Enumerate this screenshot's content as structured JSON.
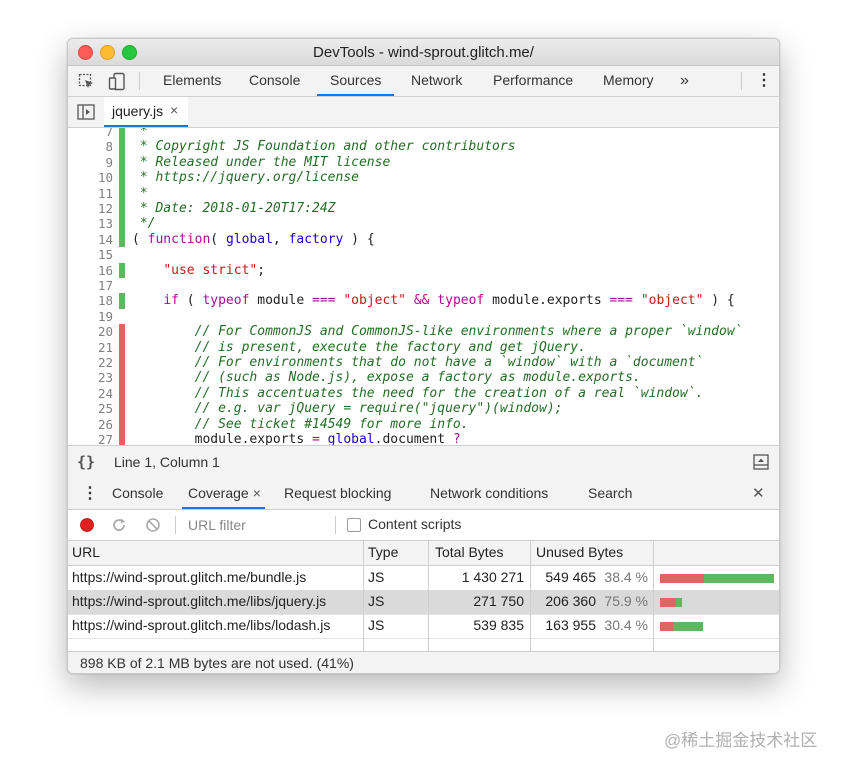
{
  "window": {
    "title": "DevTools - wind-sprout.glitch.me/"
  },
  "main_tabs": [
    "Elements",
    "Console",
    "Sources",
    "Network",
    "Performance",
    "Memory"
  ],
  "main_tabs_active": "Sources",
  "more_tabs_glyph": "»",
  "menu_glyph": "⋮",
  "file_tab": {
    "label": "jquery.js",
    "close": "×"
  },
  "colors": {
    "covered": "#5eb85e",
    "uncovered": "#e06462",
    "accent": "#1a73e8"
  },
  "code_lines": [
    {
      "num": "7",
      "cov": "used",
      "tokens": [
        {
          "t": " *",
          "c": "com"
        }
      ]
    },
    {
      "num": "8",
      "cov": "used",
      "tokens": [
        {
          "t": " * Copyright JS Foundation and other contributors",
          "c": "com"
        }
      ]
    },
    {
      "num": "9",
      "cov": "used",
      "tokens": [
        {
          "t": " * Released under the MIT license",
          "c": "com"
        }
      ]
    },
    {
      "num": "10",
      "cov": "used",
      "tokens": [
        {
          "t": " * https://jquery.org/license",
          "c": "com"
        }
      ]
    },
    {
      "num": "11",
      "cov": "used",
      "tokens": [
        {
          "t": " *",
          "c": "com"
        }
      ]
    },
    {
      "num": "12",
      "cov": "used",
      "tokens": [
        {
          "t": " * Date: 2018-01-20T17:24Z",
          "c": "com"
        }
      ]
    },
    {
      "num": "13",
      "cov": "used",
      "tokens": [
        {
          "t": " */",
          "c": "com"
        }
      ]
    },
    {
      "num": "14",
      "cov": "used",
      "tokens": [
        {
          "t": "( ",
          "c": "plain"
        },
        {
          "t": "function",
          "c": "kw"
        },
        {
          "t": "( ",
          "c": "plain"
        },
        {
          "t": "global",
          "c": "id"
        },
        {
          "t": ", ",
          "c": "plain"
        },
        {
          "t": "factory",
          "c": "id"
        },
        {
          "t": " ) {",
          "c": "plain"
        }
      ]
    },
    {
      "num": "15",
      "cov": "none",
      "tokens": []
    },
    {
      "num": "16",
      "cov": "used",
      "tokens": [
        {
          "t": "    ",
          "c": "plain"
        },
        {
          "t": "\"use strict\"",
          "c": "str"
        },
        {
          "t": ";",
          "c": "plain"
        }
      ]
    },
    {
      "num": "17",
      "cov": "none",
      "tokens": []
    },
    {
      "num": "18",
      "cov": "used",
      "tokens": [
        {
          "t": "    ",
          "c": "plain"
        },
        {
          "t": "if",
          "c": "kw"
        },
        {
          "t": " ( ",
          "c": "plain"
        },
        {
          "t": "typeof",
          "c": "kw"
        },
        {
          "t": " module ",
          "c": "plain"
        },
        {
          "t": "===",
          "c": "kw"
        },
        {
          "t": " ",
          "c": "plain"
        },
        {
          "t": "\"object\"",
          "c": "str"
        },
        {
          "t": " ",
          "c": "plain"
        },
        {
          "t": "&&",
          "c": "kw"
        },
        {
          "t": " ",
          "c": "plain"
        },
        {
          "t": "typeof",
          "c": "kw"
        },
        {
          "t": " module.exports ",
          "c": "plain"
        },
        {
          "t": "===",
          "c": "kw"
        },
        {
          "t": " ",
          "c": "plain"
        },
        {
          "t": "\"object\"",
          "c": "str"
        },
        {
          "t": " ) {",
          "c": "plain"
        }
      ]
    },
    {
      "num": "19",
      "cov": "none",
      "tokens": []
    },
    {
      "num": "20",
      "cov": "unused",
      "tokens": [
        {
          "t": "        ",
          "c": "plain"
        },
        {
          "t": "// For CommonJS and CommonJS-like environments where a proper `window`",
          "c": "lcom"
        }
      ]
    },
    {
      "num": "21",
      "cov": "unused",
      "tokens": [
        {
          "t": "        ",
          "c": "plain"
        },
        {
          "t": "// is present, execute the factory and get jQuery.",
          "c": "lcom"
        }
      ]
    },
    {
      "num": "22",
      "cov": "unused",
      "tokens": [
        {
          "t": "        ",
          "c": "plain"
        },
        {
          "t": "// For environments that do not have a `window` with a `document`",
          "c": "lcom"
        }
      ]
    },
    {
      "num": "23",
      "cov": "unused",
      "tokens": [
        {
          "t": "        ",
          "c": "plain"
        },
        {
          "t": "// (such as Node.js), expose a factory as module.exports.",
          "c": "lcom"
        }
      ]
    },
    {
      "num": "24",
      "cov": "unused",
      "tokens": [
        {
          "t": "        ",
          "c": "plain"
        },
        {
          "t": "// This accentuates the need for the creation of a real `window`.",
          "c": "lcom"
        }
      ]
    },
    {
      "num": "25",
      "cov": "unused",
      "tokens": [
        {
          "t": "        ",
          "c": "plain"
        },
        {
          "t": "// e.g. var jQuery = require(\"jquery\")(window);",
          "c": "lcom"
        }
      ]
    },
    {
      "num": "26",
      "cov": "unused",
      "tokens": [
        {
          "t": "        ",
          "c": "plain"
        },
        {
          "t": "// See ticket #14549 for more info.",
          "c": "lcom"
        }
      ]
    },
    {
      "num": "27",
      "cov": "unused",
      "tokens": [
        {
          "t": "        module.exports ",
          "c": "plain"
        },
        {
          "t": "=",
          "c": "kw"
        },
        {
          "t": " ",
          "c": "plain"
        },
        {
          "t": "global",
          "c": "id"
        },
        {
          "t": ".document ",
          "c": "plain"
        },
        {
          "t": "?",
          "c": "kw"
        }
      ]
    }
  ],
  "status": {
    "braces": "{}",
    "position": "Line 1, Column 1"
  },
  "drawer_tabs": [
    {
      "label": "Console",
      "close": ""
    },
    {
      "label": "Coverage",
      "close": "×"
    },
    {
      "label": "Request blocking",
      "close": ""
    },
    {
      "label": "Network conditions",
      "close": ""
    },
    {
      "label": "Search",
      "close": ""
    }
  ],
  "drawer_active": "Coverage",
  "drawer_close": "✕",
  "coverage_toolbar": {
    "url_filter_placeholder": "URL filter",
    "content_scripts_label": "Content scripts"
  },
  "table": {
    "headers": [
      "URL",
      "Type",
      "Total Bytes",
      "Unused Bytes"
    ],
    "rows": [
      {
        "url": "https://wind-sprout.glitch.me/bundle.js",
        "type": "JS",
        "total": "1 430 271",
        "unused": "549 465",
        "pct": "38.4 %",
        "unused_frac": 0.384,
        "size_frac": 1.0,
        "selected": false
      },
      {
        "url": "https://wind-sprout.glitch.me/libs/jquery.js",
        "type": "JS",
        "total": "271 750",
        "unused": "206 360",
        "pct": "75.9 %",
        "unused_frac": 0.759,
        "size_frac": 0.19,
        "selected": true
      },
      {
        "url": "https://wind-sprout.glitch.me/libs/lodash.js",
        "type": "JS",
        "total": "539 835",
        "unused": "163 955",
        "pct": "30.4 %",
        "unused_frac": 0.304,
        "size_frac": 0.377,
        "selected": false
      }
    ]
  },
  "footer": {
    "summary": "898 KB of 2.1 MB bytes are not used. (41%)"
  },
  "watermark": "@稀土掘金技术社区"
}
